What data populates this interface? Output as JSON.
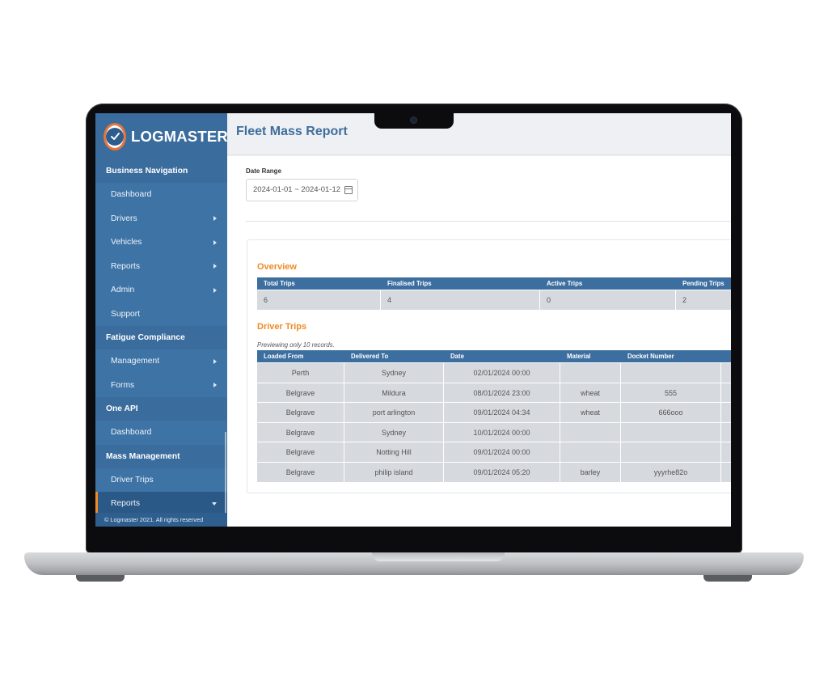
{
  "brand": {
    "name": "LOGMASTER"
  },
  "sidebar": {
    "groups": [
      {
        "title": "Business Navigation",
        "items": [
          {
            "label": "Dashboard",
            "arrow": false
          },
          {
            "label": "Drivers",
            "arrow": true
          },
          {
            "label": "Vehicles",
            "arrow": true
          },
          {
            "label": "Reports",
            "arrow": true
          },
          {
            "label": "Admin",
            "arrow": true
          },
          {
            "label": "Support",
            "arrow": false
          }
        ]
      },
      {
        "title": "Fatigue Compliance",
        "items": [
          {
            "label": "Management",
            "arrow": true
          },
          {
            "label": "Forms",
            "arrow": true
          }
        ]
      },
      {
        "title": "One API",
        "items": [
          {
            "label": "Dashboard",
            "arrow": false
          }
        ]
      },
      {
        "title": "Mass Management",
        "items": [
          {
            "label": "Driver Trips",
            "arrow": false
          },
          {
            "label": "Reports",
            "arrow": true,
            "active": true
          }
        ]
      }
    ],
    "copyright": "© Logmaster 2021. All rights reserved"
  },
  "page": {
    "title": "Fleet Mass Report"
  },
  "filters": {
    "date_range_label": "Date Range",
    "date_range_value": "2024-01-01 ~ 2024-01-12"
  },
  "overview": {
    "title": "Overview",
    "headers": [
      "Total Trips",
      "Finalised Trips",
      "Active Trips",
      "Pending Trips"
    ],
    "values": [
      "6",
      "4",
      "0",
      "2"
    ]
  },
  "driver_trips": {
    "title": "Driver Trips",
    "note": "Previewing only 10 records.",
    "headers": [
      "Loaded From",
      "Delivered To",
      "Date",
      "Material",
      "Docket Number",
      ""
    ],
    "rows": [
      [
        "Perth",
        "Sydney",
        "02/01/2024 00:00",
        "",
        "",
        ""
      ],
      [
        "Belgrave",
        "Mildura",
        "08/01/2024 23:00",
        "wheat",
        "555",
        ""
      ],
      [
        "Belgrave",
        "port arlington",
        "09/01/2024 04:34",
        "wheat",
        "666ooo",
        ""
      ],
      [
        "Belgrave",
        "Sydney",
        "10/01/2024 00:00",
        "",
        "",
        ""
      ],
      [
        "Belgrave",
        "Notting Hill",
        "09/01/2024 00:00",
        "",
        "",
        ""
      ],
      [
        "Belgrave",
        "philip island",
        "09/01/2024 05:20",
        "barley",
        "yyyrhe82o",
        ""
      ]
    ]
  },
  "colors": {
    "sidebar": "#3e73a5",
    "header": "#3c6e9f",
    "accent": "#f08a24",
    "title": "#3f6e9c"
  }
}
